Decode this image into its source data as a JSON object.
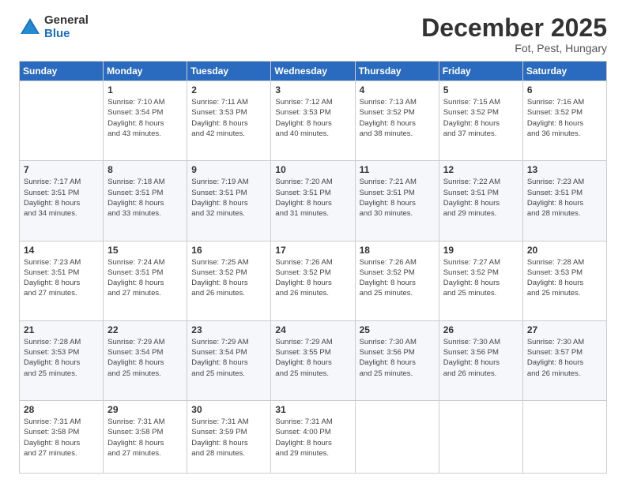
{
  "header": {
    "logo_general": "General",
    "logo_blue": "Blue",
    "month_title": "December 2025",
    "subtitle": "Fot, Pest, Hungary"
  },
  "weekdays": [
    "Sunday",
    "Monday",
    "Tuesday",
    "Wednesday",
    "Thursday",
    "Friday",
    "Saturday"
  ],
  "weeks": [
    [
      {
        "num": "",
        "info": ""
      },
      {
        "num": "1",
        "info": "Sunrise: 7:10 AM\nSunset: 3:54 PM\nDaylight: 8 hours\nand 43 minutes."
      },
      {
        "num": "2",
        "info": "Sunrise: 7:11 AM\nSunset: 3:53 PM\nDaylight: 8 hours\nand 42 minutes."
      },
      {
        "num": "3",
        "info": "Sunrise: 7:12 AM\nSunset: 3:53 PM\nDaylight: 8 hours\nand 40 minutes."
      },
      {
        "num": "4",
        "info": "Sunrise: 7:13 AM\nSunset: 3:52 PM\nDaylight: 8 hours\nand 38 minutes."
      },
      {
        "num": "5",
        "info": "Sunrise: 7:15 AM\nSunset: 3:52 PM\nDaylight: 8 hours\nand 37 minutes."
      },
      {
        "num": "6",
        "info": "Sunrise: 7:16 AM\nSunset: 3:52 PM\nDaylight: 8 hours\nand 36 minutes."
      }
    ],
    [
      {
        "num": "7",
        "info": "Sunrise: 7:17 AM\nSunset: 3:51 PM\nDaylight: 8 hours\nand 34 minutes."
      },
      {
        "num": "8",
        "info": "Sunrise: 7:18 AM\nSunset: 3:51 PM\nDaylight: 8 hours\nand 33 minutes."
      },
      {
        "num": "9",
        "info": "Sunrise: 7:19 AM\nSunset: 3:51 PM\nDaylight: 8 hours\nand 32 minutes."
      },
      {
        "num": "10",
        "info": "Sunrise: 7:20 AM\nSunset: 3:51 PM\nDaylight: 8 hours\nand 31 minutes."
      },
      {
        "num": "11",
        "info": "Sunrise: 7:21 AM\nSunset: 3:51 PM\nDaylight: 8 hours\nand 30 minutes."
      },
      {
        "num": "12",
        "info": "Sunrise: 7:22 AM\nSunset: 3:51 PM\nDaylight: 8 hours\nand 29 minutes."
      },
      {
        "num": "13",
        "info": "Sunrise: 7:23 AM\nSunset: 3:51 PM\nDaylight: 8 hours\nand 28 minutes."
      }
    ],
    [
      {
        "num": "14",
        "info": "Sunrise: 7:23 AM\nSunset: 3:51 PM\nDaylight: 8 hours\nand 27 minutes."
      },
      {
        "num": "15",
        "info": "Sunrise: 7:24 AM\nSunset: 3:51 PM\nDaylight: 8 hours\nand 27 minutes."
      },
      {
        "num": "16",
        "info": "Sunrise: 7:25 AM\nSunset: 3:52 PM\nDaylight: 8 hours\nand 26 minutes."
      },
      {
        "num": "17",
        "info": "Sunrise: 7:26 AM\nSunset: 3:52 PM\nDaylight: 8 hours\nand 26 minutes."
      },
      {
        "num": "18",
        "info": "Sunrise: 7:26 AM\nSunset: 3:52 PM\nDaylight: 8 hours\nand 25 minutes."
      },
      {
        "num": "19",
        "info": "Sunrise: 7:27 AM\nSunset: 3:52 PM\nDaylight: 8 hours\nand 25 minutes."
      },
      {
        "num": "20",
        "info": "Sunrise: 7:28 AM\nSunset: 3:53 PM\nDaylight: 8 hours\nand 25 minutes."
      }
    ],
    [
      {
        "num": "21",
        "info": "Sunrise: 7:28 AM\nSunset: 3:53 PM\nDaylight: 8 hours\nand 25 minutes."
      },
      {
        "num": "22",
        "info": "Sunrise: 7:29 AM\nSunset: 3:54 PM\nDaylight: 8 hours\nand 25 minutes."
      },
      {
        "num": "23",
        "info": "Sunrise: 7:29 AM\nSunset: 3:54 PM\nDaylight: 8 hours\nand 25 minutes."
      },
      {
        "num": "24",
        "info": "Sunrise: 7:29 AM\nSunset: 3:55 PM\nDaylight: 8 hours\nand 25 minutes."
      },
      {
        "num": "25",
        "info": "Sunrise: 7:30 AM\nSunset: 3:56 PM\nDaylight: 8 hours\nand 25 minutes."
      },
      {
        "num": "26",
        "info": "Sunrise: 7:30 AM\nSunset: 3:56 PM\nDaylight: 8 hours\nand 26 minutes."
      },
      {
        "num": "27",
        "info": "Sunrise: 7:30 AM\nSunset: 3:57 PM\nDaylight: 8 hours\nand 26 minutes."
      }
    ],
    [
      {
        "num": "28",
        "info": "Sunrise: 7:31 AM\nSunset: 3:58 PM\nDaylight: 8 hours\nand 27 minutes."
      },
      {
        "num": "29",
        "info": "Sunrise: 7:31 AM\nSunset: 3:58 PM\nDaylight: 8 hours\nand 27 minutes."
      },
      {
        "num": "30",
        "info": "Sunrise: 7:31 AM\nSunset: 3:59 PM\nDaylight: 8 hours\nand 28 minutes."
      },
      {
        "num": "31",
        "info": "Sunrise: 7:31 AM\nSunset: 4:00 PM\nDaylight: 8 hours\nand 29 minutes."
      },
      {
        "num": "",
        "info": ""
      },
      {
        "num": "",
        "info": ""
      },
      {
        "num": "",
        "info": ""
      }
    ]
  ]
}
